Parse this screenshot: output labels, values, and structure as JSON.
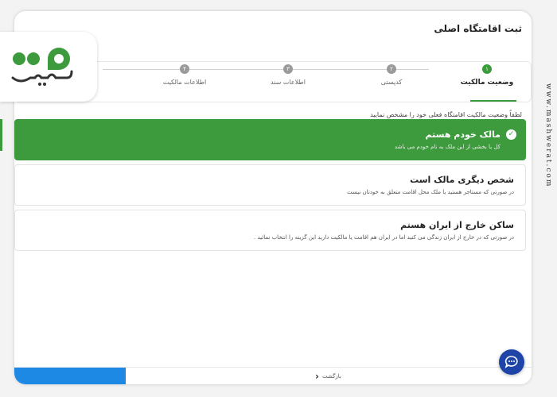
{
  "page": {
    "title": "ثبت اقامتگاه اصلی",
    "instruction": "لطفاً وضعیت مالکیت اقامتگاه فعلی خود را مشخص نمایید"
  },
  "stepper": {
    "steps": [
      {
        "number": "۱",
        "label": "وضعیت مالکیت",
        "state": "active"
      },
      {
        "number": "۲",
        "label": "کدپستی",
        "state": "todo"
      },
      {
        "number": "۳",
        "label": "اطلاعات سند",
        "state": "todo"
      },
      {
        "number": "۴",
        "label": "اطلاعات مالکیت",
        "state": "todo"
      }
    ]
  },
  "options": [
    {
      "title": "مالک خودم هستم",
      "desc": "کل یا بخشی از این ملک به نام خودم می باشد",
      "selected": true
    },
    {
      "title": "شخص دیگری مالک است",
      "desc": "در صورتی که مستاجر هستید یا ملک محل اقامت متعلق به خودتان نیست",
      "selected": false
    },
    {
      "title": "ساکن خارج از ایران هستم",
      "desc": "در صورتی که در خارج از ایران زندگی می کنید اما در ایران هم اقامت یا مالکیت دارید این گزینه را انتخاب نمائید .",
      "selected": false
    }
  ],
  "bottom": {
    "back_label": "بازگشت"
  },
  "logo": {
    "text": "مشورت"
  },
  "watermark": "www.mashwerat.com",
  "colors": {
    "accent_green": "#3d9a3d",
    "primary_blue": "#1e88e5",
    "chat_blue": "#1e44a8"
  },
  "icons": {
    "check": "check-circle-icon",
    "back": "chevron-left-icon",
    "chat": "chat-bubble-icon"
  }
}
